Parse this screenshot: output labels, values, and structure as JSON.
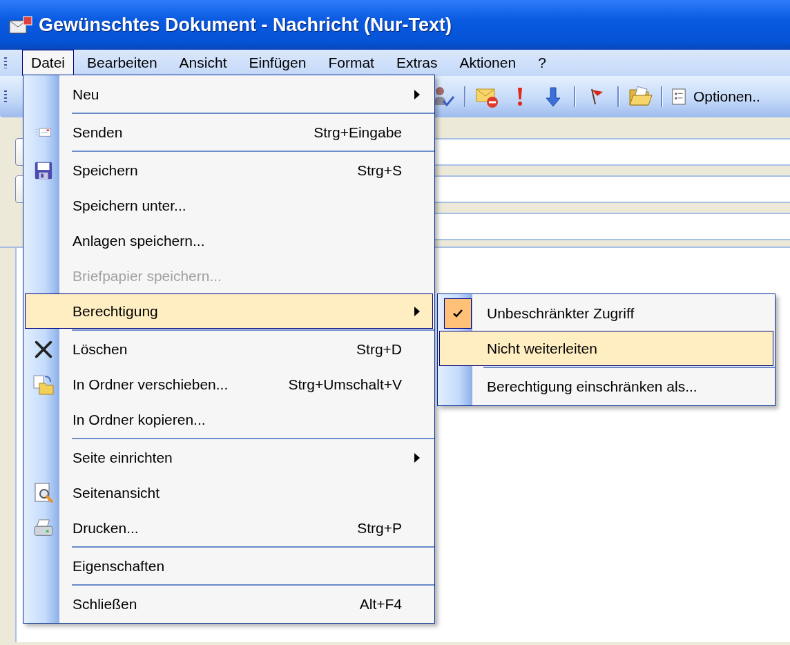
{
  "window": {
    "title": "Gewünschtes Dokument - Nachricht (Nur-Text)"
  },
  "menu_bar": [
    {
      "label": "Datei",
      "selected": true
    },
    {
      "label": "Bearbeiten",
      "selected": false
    },
    {
      "label": "Ansicht",
      "selected": false
    },
    {
      "label": "Einfügen",
      "selected": false
    },
    {
      "label": "Format",
      "selected": false
    },
    {
      "label": "Extras",
      "selected": false
    },
    {
      "label": "Aktionen",
      "selected": false
    },
    {
      "label": "?",
      "selected": false
    }
  ],
  "toolbar": {
    "options_button": "Optionen.."
  },
  "file_menu": {
    "groups": [
      [
        {
          "kind": "plain",
          "label": "Neu",
          "submenu": true,
          "disabled": false,
          "selected": false
        }
      ],
      [
        {
          "kind": "send",
          "label": "Senden",
          "shortcut": "Strg+Eingabe",
          "submenu": false,
          "disabled": false,
          "selected": false
        }
      ],
      [
        {
          "kind": "save",
          "label": "Speichern",
          "shortcut": "Strg+S",
          "submenu": false,
          "disabled": false,
          "selected": false
        },
        {
          "kind": "plain",
          "label": "Speichern unter...",
          "submenu": false,
          "disabled": false,
          "selected": false
        },
        {
          "kind": "plain",
          "label": "Anlagen speichern...",
          "submenu": false,
          "disabled": false,
          "selected": false
        },
        {
          "kind": "plain",
          "label": "Briefpapier speichern...",
          "submenu": false,
          "disabled": true,
          "selected": false
        },
        {
          "kind": "plain",
          "label": "Berechtigung",
          "submenu": true,
          "disabled": false,
          "selected": true
        }
      ],
      [
        {
          "kind": "delete",
          "label": "Löschen",
          "shortcut": "Strg+D",
          "submenu": false,
          "disabled": false,
          "selected": false
        },
        {
          "kind": "move",
          "label": "In Ordner verschieben...",
          "shortcut": "Strg+Umschalt+V",
          "submenu": false,
          "disabled": false,
          "selected": false
        },
        {
          "kind": "plain",
          "label": "In Ordner kopieren...",
          "submenu": false,
          "disabled": false,
          "selected": false
        }
      ],
      [
        {
          "kind": "plain",
          "label": "Seite einrichten",
          "submenu": true,
          "disabled": false,
          "selected": false
        },
        {
          "kind": "preview",
          "label": "Seitenansicht",
          "submenu": false,
          "disabled": false,
          "selected": false
        },
        {
          "kind": "print",
          "label": "Drucken...",
          "shortcut": "Strg+P",
          "submenu": false,
          "disabled": false,
          "selected": false
        }
      ],
      [
        {
          "kind": "plain",
          "label": "Eigenschaften",
          "submenu": false,
          "disabled": false,
          "selected": false
        }
      ],
      [
        {
          "kind": "plain",
          "label": "Schließen",
          "shortcut": "Alt+F4",
          "submenu": false,
          "disabled": false,
          "selected": false
        }
      ]
    ]
  },
  "permission_submenu": {
    "groups": [
      [
        {
          "label": "Unbeschränkter Zugriff",
          "checked": true,
          "selected": false
        },
        {
          "label": "Nicht weiterleiten",
          "checked": false,
          "selected": true
        }
      ],
      [
        {
          "label": "Berechtigung einschränken als...",
          "checked": false,
          "selected": false
        }
      ]
    ]
  }
}
